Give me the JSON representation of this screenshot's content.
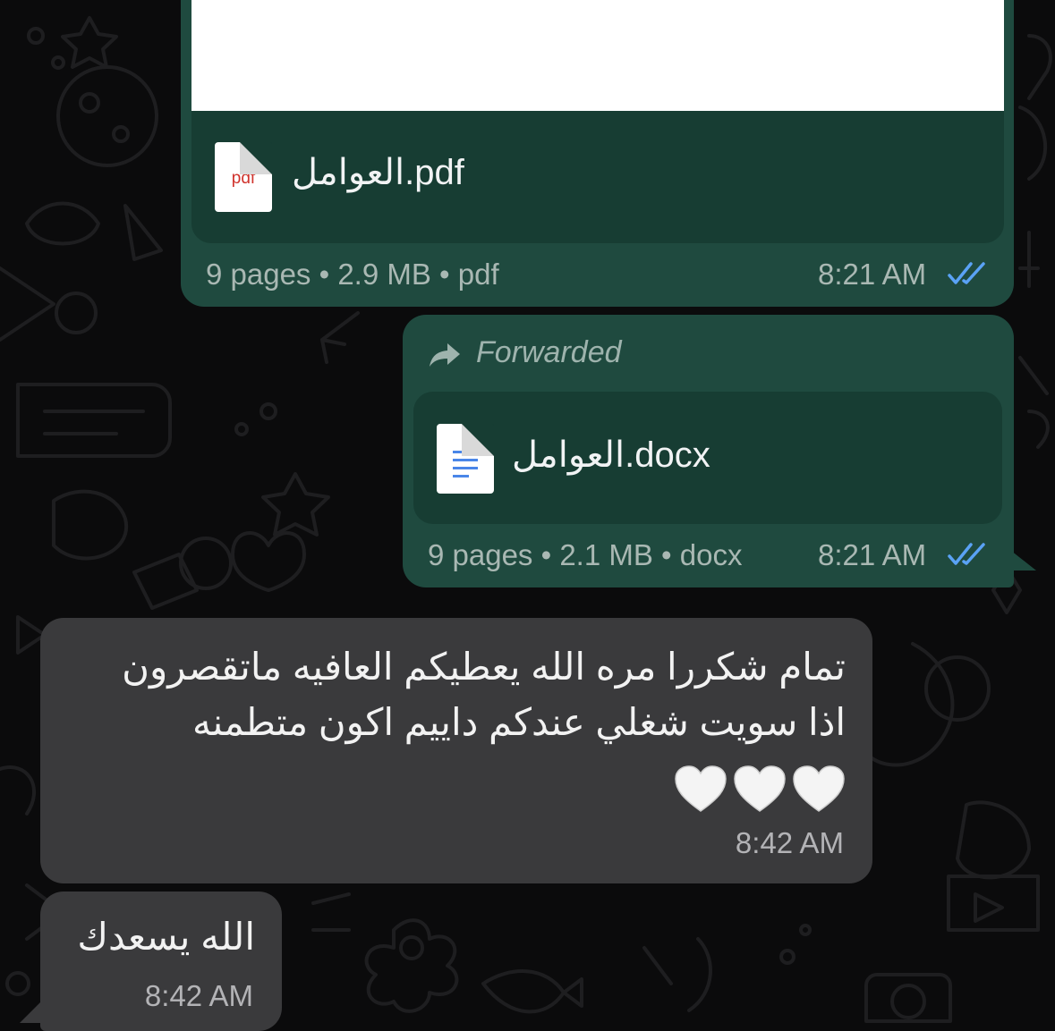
{
  "colors": {
    "background": "#0b0b0c",
    "outgoing_bubble": "#1f4a3f",
    "outgoing_card": "#173d33",
    "incoming_bubble": "#3a3a3c",
    "read_ticks": "#5aa2f5"
  },
  "messages": [
    {
      "direction": "outgoing",
      "file": {
        "name": "العوامل.pdf",
        "icon": "pdf-file-icon",
        "icon_label": "pdf"
      },
      "meta": "9 pages • 2.9 MB • pdf",
      "time": "8:21 AM",
      "status_icon": "double-check-icon"
    },
    {
      "direction": "outgoing",
      "forwarded_label": "Forwarded",
      "forward_icon": "forward-arrow-icon",
      "file": {
        "name": "العوامل.docx",
        "icon": "docx-file-icon"
      },
      "meta": "9 pages • 2.1 MB • docx",
      "time": "8:21 AM",
      "status_icon": "double-check-icon"
    },
    {
      "direction": "incoming",
      "lines": [
        "تمام شكررا مره الله يعطيكم العافيه ماتقصرون",
        "اذا سويت شغلي عندكم داييم اكون متطمنه"
      ],
      "emoji": "🤍🤍🤍",
      "time": "8:42 AM"
    },
    {
      "direction": "incoming",
      "text": "الله يسعدك",
      "time": "8:42 AM"
    }
  ]
}
